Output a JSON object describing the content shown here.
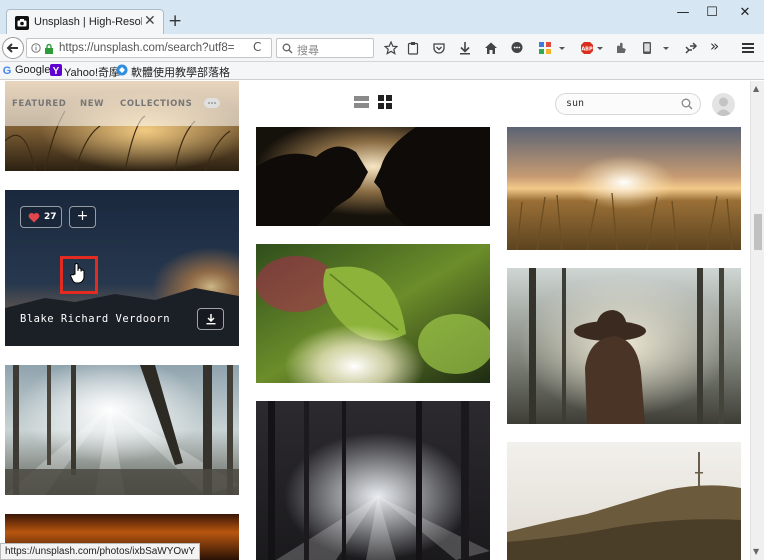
{
  "browser": {
    "tab_title": "Unsplash | High-Resoluti...",
    "url": "https://unsplash.com/search?utf8=",
    "search_placeholder": "搜尋",
    "new_tab_glyph": "+",
    "tab_close_glyph": "✕",
    "reload_glyph": "C",
    "overflow_glyph": "»",
    "window_controls": {
      "minimize": "—",
      "maximize": "☐",
      "close": "✕"
    },
    "bookmarks": [
      {
        "label": "Google",
        "icon": "google-icon"
      },
      {
        "label": "Yahoo!奇摩",
        "icon": "yahoo-icon"
      },
      {
        "label": "軟體使用教學部落格",
        "icon": "blog-icon"
      }
    ],
    "status_url": "https://unsplash.com/photos/ixbSaWYOwY"
  },
  "site": {
    "nav": [
      "FEATURED",
      "NEW",
      "COLLECTIONS"
    ],
    "search_value": "sun",
    "view_modes": [
      "list-view-icon",
      "grid-view-icon"
    ],
    "active_view": "grid-view-icon"
  },
  "hover_card": {
    "likes": "27",
    "add_glyph": "+",
    "author": "Blake Richard Verdoorn"
  },
  "colors": {
    "titlebar": "#d6e6f3",
    "highlight_box": "#e32b22",
    "heart": "#e0464c"
  }
}
